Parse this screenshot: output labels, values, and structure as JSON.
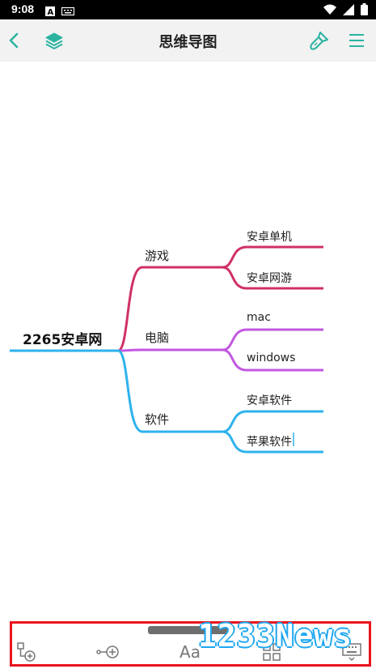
{
  "status_bar": {
    "time": "9:08",
    "left_icons": [
      "a-badge-icon",
      "keyboard-icon"
    ],
    "right_icons": [
      "wifi-icon",
      "signal-icon",
      "battery-icon"
    ]
  },
  "header": {
    "title": "思维导图",
    "accent_color": "#2bb3a0"
  },
  "mindmap": {
    "root": "2265安卓网",
    "branches": [
      {
        "label": "游戏",
        "color": "#d03068",
        "children": [
          "安卓单机",
          "安卓网游"
        ]
      },
      {
        "label": "电脑",
        "color": "#c257e0",
        "children": [
          "mac",
          "windows"
        ]
      },
      {
        "label": "软件",
        "color": "#2eb2ec",
        "children": [
          "安卓软件",
          "苹果软件"
        ]
      }
    ]
  },
  "toolbar": {
    "tools": [
      "add-child-node-icon",
      "add-sibling-node-icon",
      "text-style-icon",
      "layout-grid-icon",
      "keyboard-hide-icon"
    ],
    "text_style_label": "Aa",
    "highlight_color": "#e8141e"
  },
  "watermark": {
    "text": "1233News"
  }
}
